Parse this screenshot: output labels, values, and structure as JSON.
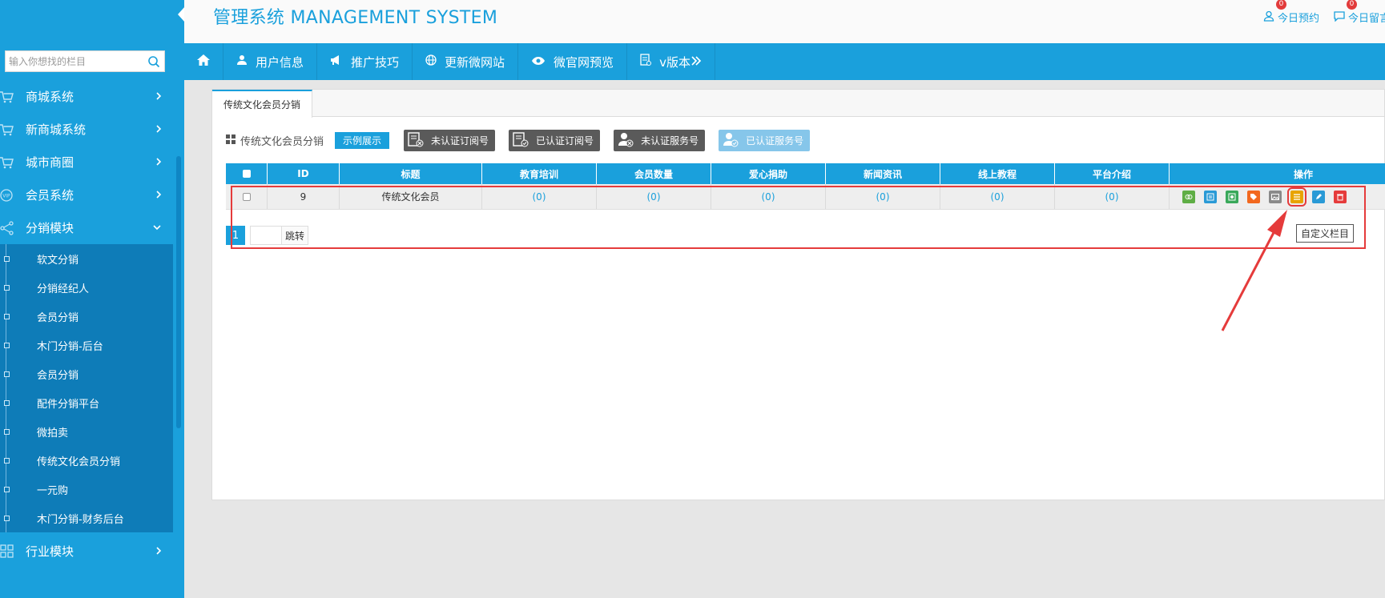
{
  "header": {
    "title": "管理系统 MANAGEMENT SYSTEM",
    "right_links": [
      {
        "label": "今日预约",
        "badge": "0"
      },
      {
        "label": "今日留言",
        "badge": "0"
      }
    ]
  },
  "sidebar": {
    "search": {
      "placeholder": "输入你想找的栏目"
    },
    "items": [
      {
        "label": "商城系统"
      },
      {
        "label": "新商城系统"
      },
      {
        "label": "城市商圈"
      },
      {
        "label": "会员系统"
      },
      {
        "label": "分销模块",
        "expanded": true
      }
    ],
    "submenu": [
      "软文分销",
      "分销经纪人",
      "会员分销",
      "木门分销-后台",
      "会员分销",
      "配件分销平台",
      "微拍卖",
      "传统文化会员分销",
      "一元购",
      "木门分销-财务后台"
    ],
    "after": [
      {
        "label": "行业模块"
      }
    ]
  },
  "navbar": {
    "items": [
      {
        "label": "用户信息"
      },
      {
        "label": "推广技巧"
      },
      {
        "label": "更新微网站"
      },
      {
        "label": "微官网预览"
      },
      {
        "label": "v版本"
      }
    ]
  },
  "main": {
    "tab_label": "传统文化会员分销",
    "toolbar_label": "传统文化会员分销",
    "demo_button": "示例展示",
    "account_buttons": [
      {
        "label": "未认证订阅号"
      },
      {
        "label": "已认证订阅号"
      },
      {
        "label": "未认证服务号"
      },
      {
        "label": "已认证服务号",
        "active": true
      }
    ],
    "table": {
      "headers": [
        "ID",
        "标题",
        "教育培训",
        "会员数量",
        "爱心捐助",
        "新闻资讯",
        "线上教程",
        "平台介绍",
        "操作"
      ],
      "rows": [
        {
          "id": "9",
          "title": "传统文化会员",
          "values": [
            "(0)",
            "(0)",
            "(0)",
            "(0)",
            "(0)",
            "(0)"
          ]
        }
      ]
    },
    "pager": {
      "current": "1",
      "jump_label": "跳转"
    },
    "tooltip": "自定义栏目"
  },
  "colors": {
    "accent": "#1aa0dc",
    "sidebar_sub": "#0e7cb8",
    "annotation": "#e53b3b"
  }
}
